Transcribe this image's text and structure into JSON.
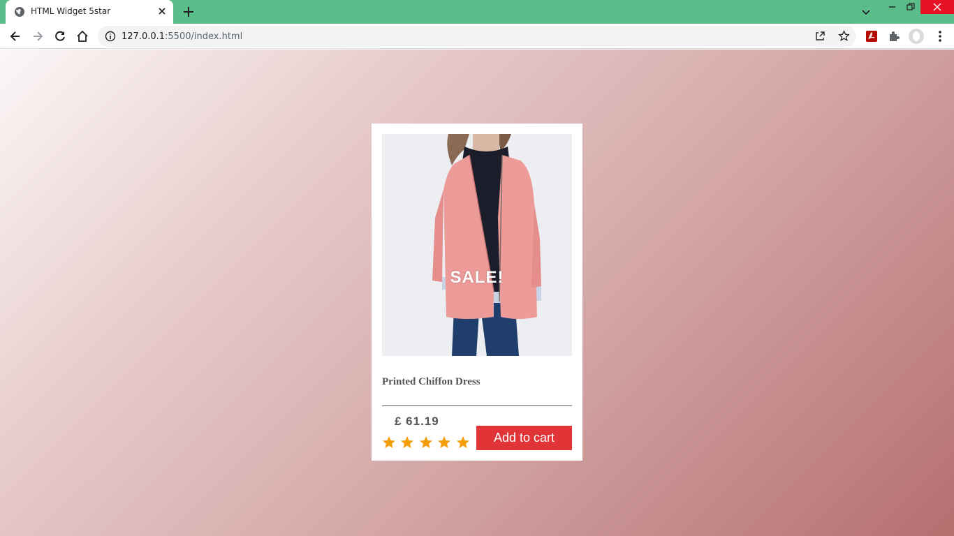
{
  "browser": {
    "tab_title": "HTML Widget 5star",
    "url_host": "127.0.0.1",
    "url_rest": ":5500/index.html"
  },
  "product": {
    "badge": "SALE!",
    "name": "Printed Chiffon Dress",
    "price": "£ 61.19",
    "rating": 5,
    "rating_max": 5,
    "cart_label": "Add to cart"
  },
  "colors": {
    "titlebar": "#5bbd8a",
    "star": "#f59e0b",
    "cart_button": "#e03436"
  }
}
